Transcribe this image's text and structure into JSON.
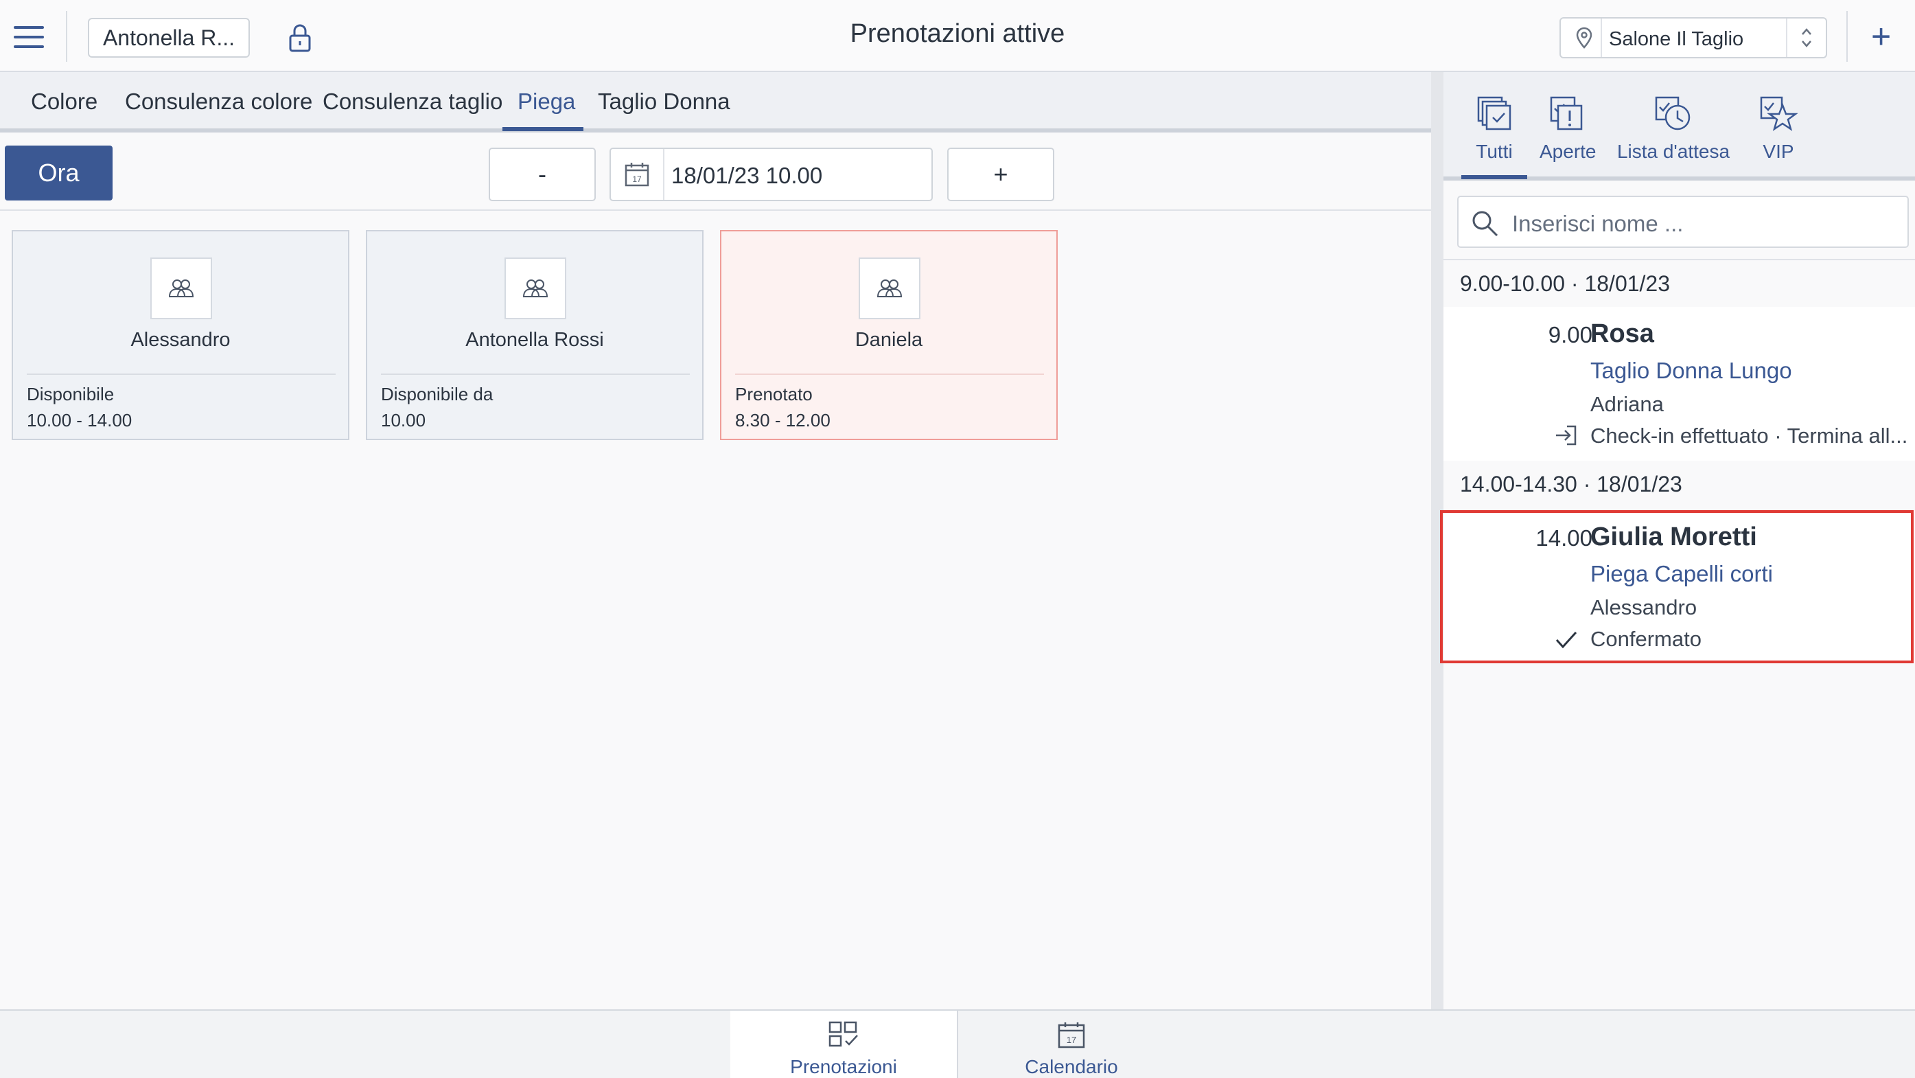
{
  "header": {
    "user_button": "Antonella R...",
    "title": "Prenotazioni attive",
    "salon": "Salone Il Taglio"
  },
  "service_tabs": [
    {
      "label": "Colore"
    },
    {
      "label": "Consulenza colore"
    },
    {
      "label": "Consulenza taglio"
    },
    {
      "label": "Piega",
      "active": true
    },
    {
      "label": "Taglio Donna"
    }
  ],
  "toolbar": {
    "now_label": "Ora",
    "minus_label": "-",
    "plus_label": "+",
    "date_value": "18/01/23 10.00",
    "calendar_day": "17"
  },
  "staff": [
    {
      "name": "Alessandro",
      "status": "Disponibile",
      "time": "10.00 - 14.00",
      "booked": false
    },
    {
      "name": "Antonella Rossi",
      "status": "Disponibile da",
      "time": "10.00",
      "booked": false
    },
    {
      "name": "Daniela",
      "status": "Prenotato",
      "time": "8.30 - 12.00",
      "booked": true
    }
  ],
  "filters": [
    {
      "label": "Tutti",
      "icon": "all-icon",
      "active": true
    },
    {
      "label": "Aperte",
      "icon": "open-icon"
    },
    {
      "label": "Lista d'attesa",
      "icon": "waitlist-icon"
    },
    {
      "label": "VIP",
      "icon": "vip-star-icon"
    }
  ],
  "search": {
    "placeholder": "Inserisci nome ..."
  },
  "slots": [
    {
      "header": "9.00-10.00 · 18/01/23",
      "appointment": {
        "time": "9.00",
        "client": "Rosa",
        "service": "Taglio Donna Lungo",
        "operator": "Adriana",
        "status": "Check-in effettuato · Termina all...",
        "status_icon": "check-in-icon"
      }
    },
    {
      "header": "14.00-14.30 · 18/01/23",
      "appointment": {
        "time": "14.00",
        "client": "Giulia Moretti",
        "service": "Piega Capelli corti",
        "operator": "Alessandro",
        "status": "Confermato",
        "status_icon": "checkmark-icon"
      }
    }
  ],
  "bottom_nav": [
    {
      "label": "Prenotazioni",
      "active": true
    },
    {
      "label": "Calendario",
      "calendar_day": "17"
    }
  ],
  "colors": {
    "accent": "#3b5893",
    "booked_bg": "#fdf2f1",
    "booked_border": "#ef9d98",
    "highlight": "#e03a34"
  }
}
